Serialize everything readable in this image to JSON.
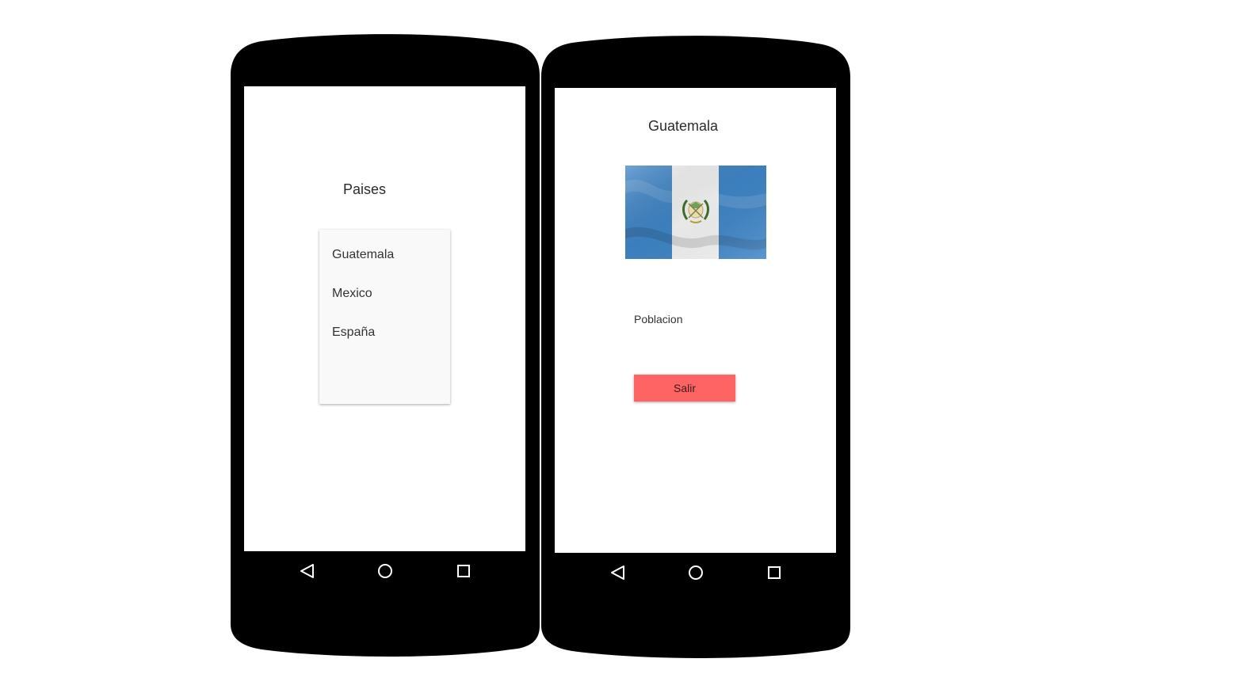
{
  "screens": [
    {
      "title": "Paises",
      "items": [
        {
          "label": "Guatemala"
        },
        {
          "label": "Mexico"
        },
        {
          "label": "España"
        }
      ]
    },
    {
      "title": "Guatemala",
      "flag": {
        "icon": "guatemala-flag-image",
        "colors": {
          "blue": "#4997d0",
          "white": "#ffffff"
        }
      },
      "population_label": "Poblacion",
      "exit_button": {
        "label": "Salir",
        "color": "#fe6464"
      }
    }
  ],
  "nav_bar": {
    "icons": [
      "back-triangle-icon",
      "home-circle-icon",
      "recents-square-icon"
    ]
  },
  "colors": {
    "phone_body": "#000000",
    "screen": "#ffffff",
    "card": "#f9f9f9"
  }
}
